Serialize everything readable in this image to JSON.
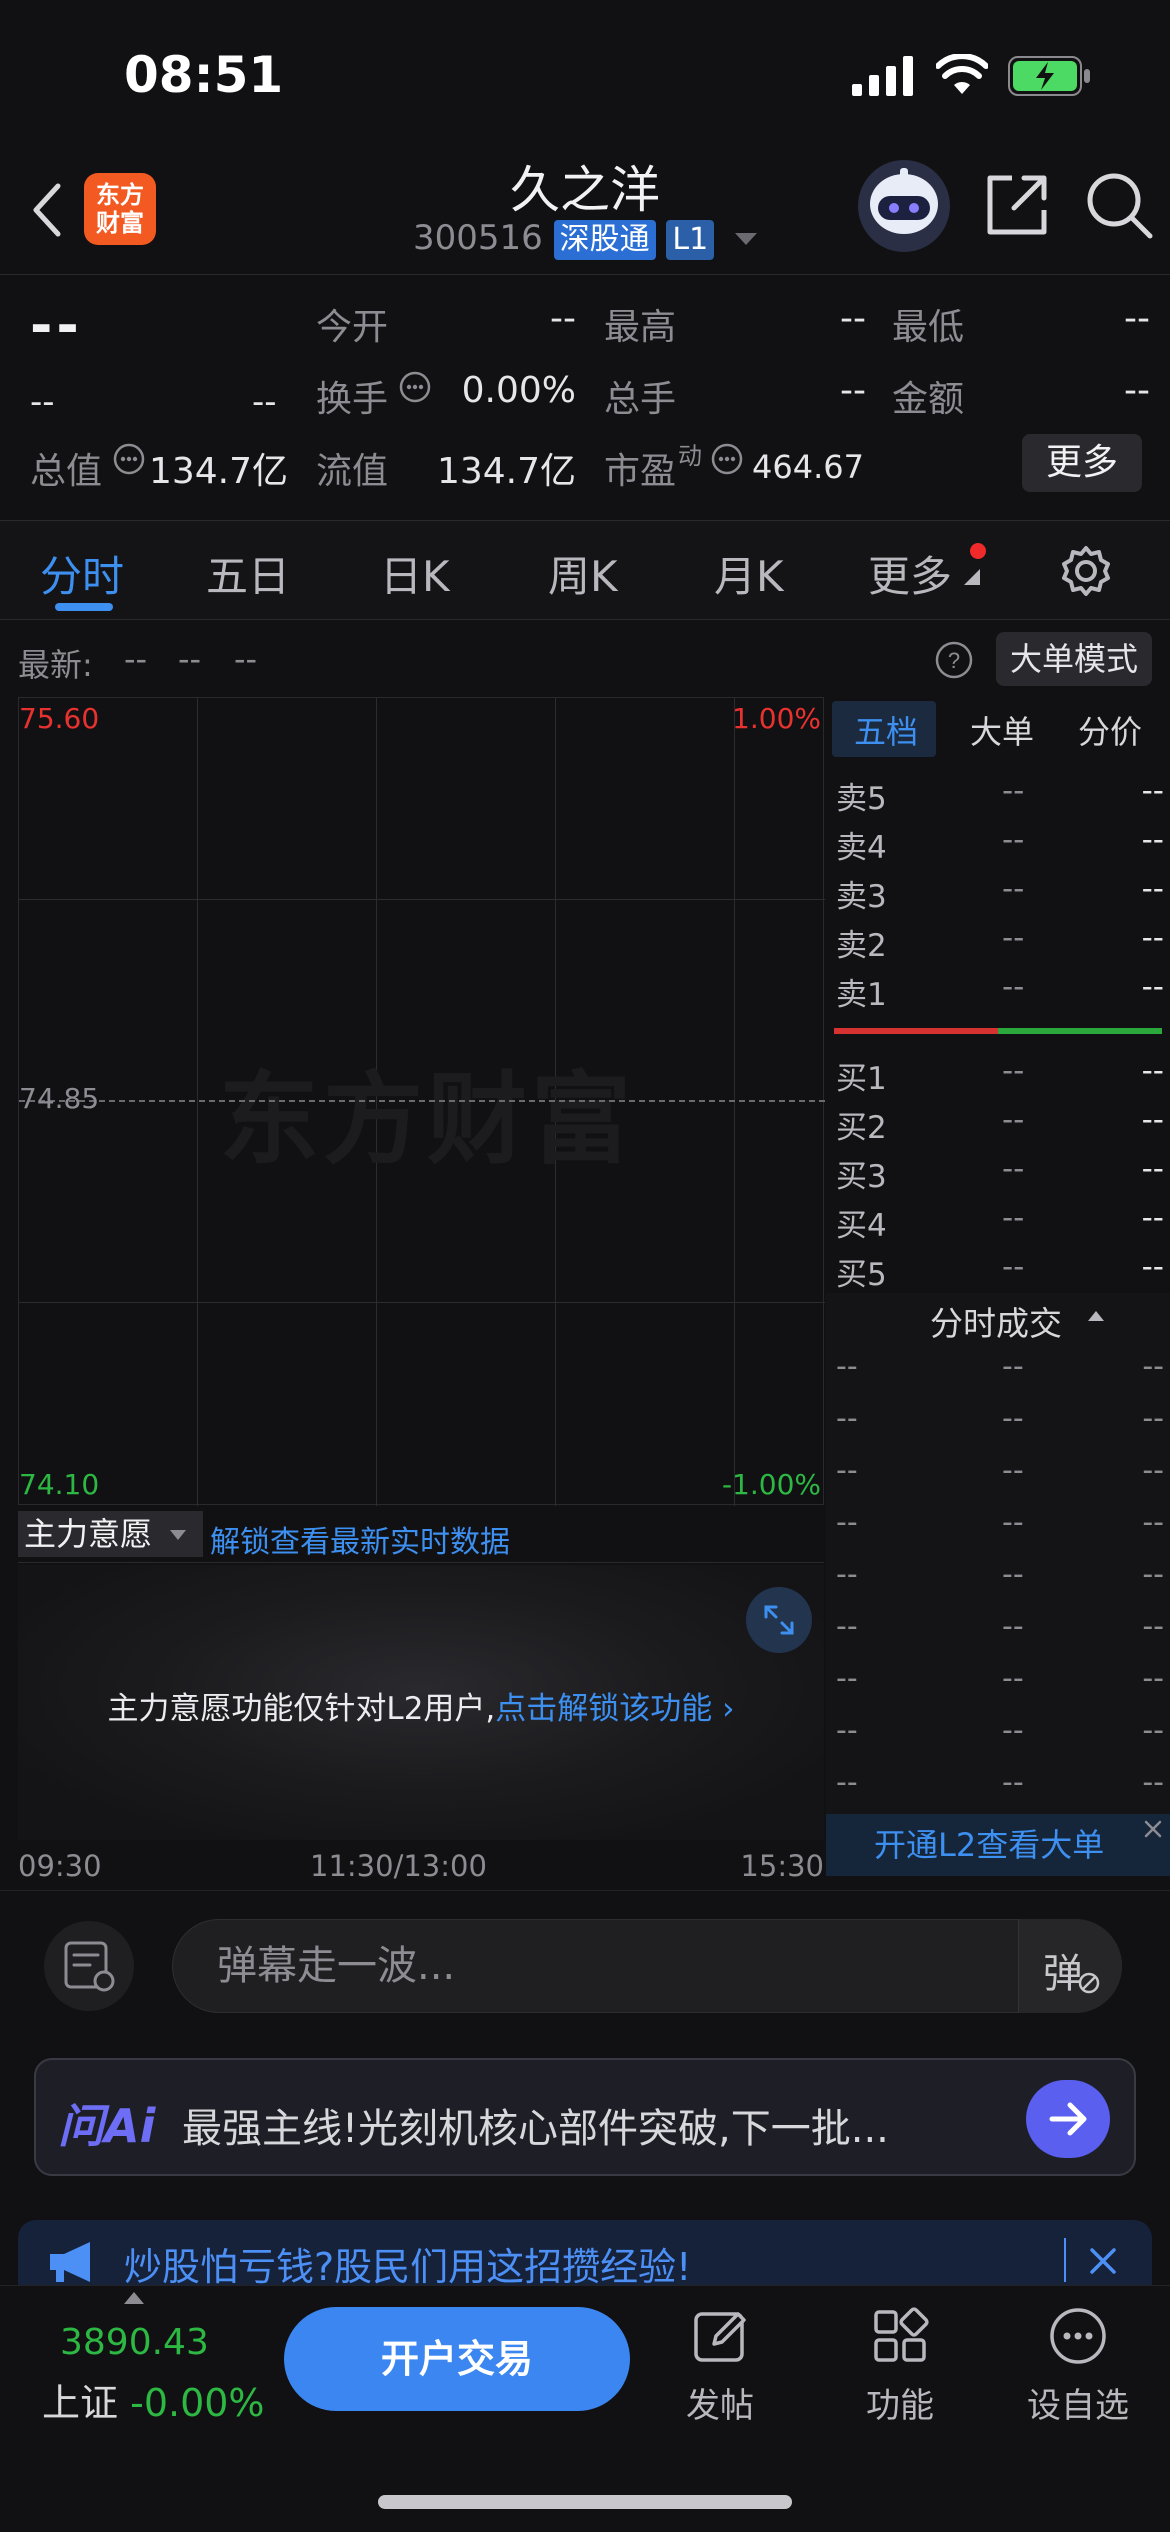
{
  "status": {
    "time": "08:51"
  },
  "header": {
    "name": "久之洋",
    "code": "300516",
    "connect_tag": "深股通",
    "level_tag": "L1",
    "logo_text_1": "东方",
    "logo_text_2": "财富"
  },
  "quote": {
    "price": "--",
    "change": "--",
    "change_pct": "--",
    "open_label": "今开",
    "open_val": "--",
    "high_label": "最高",
    "high_val": "--",
    "low_label": "最低",
    "low_val": "--",
    "turnover_label": "换手",
    "turnover_val": "0.00%",
    "volume_label": "总手",
    "volume_val": "--",
    "amount_label": "金额",
    "amount_val": "--",
    "mktcap_label": "总值",
    "mktcap_val": "134.7亿",
    "float_label": "流值",
    "float_val": "134.7亿",
    "pe_label": "市盈",
    "pe_sup": "动",
    "pe_val": "464.67",
    "more_label": "更多"
  },
  "tabs": [
    {
      "label": "分时",
      "active": true
    },
    {
      "label": "五日"
    },
    {
      "label": "日K"
    },
    {
      "label": "周K"
    },
    {
      "label": "月K"
    },
    {
      "label": "更多"
    }
  ],
  "latest": {
    "label": "最新:",
    "v1": "--",
    "v2": "--",
    "v3": "--",
    "bigorder_label": "大单模式"
  },
  "chart": {
    "y_top": "75.60",
    "y_mid": "74.85",
    "y_bottom": "74.10",
    "pct_top": "1.00%",
    "pct_bottom": "-1.00%",
    "watermark": "东方财富",
    "time_start": "09:30",
    "time_mid": "11:30/13:00",
    "time_end": "15:30"
  },
  "main_force": {
    "select_label": "主力意愿",
    "unlock_link": "解锁查看最新实时数据",
    "panel_text": "主力意愿功能仅针对L2用户,",
    "panel_link": "点击解锁该功能"
  },
  "order_book": {
    "tabs": [
      "五档",
      "大单",
      "分价"
    ],
    "sell": [
      {
        "name": "卖5",
        "price": "--",
        "vol": "--"
      },
      {
        "name": "卖4",
        "price": "--",
        "vol": "--"
      },
      {
        "name": "卖3",
        "price": "--",
        "vol": "--"
      },
      {
        "name": "卖2",
        "price": "--",
        "vol": "--"
      },
      {
        "name": "卖1",
        "price": "--",
        "vol": "--"
      }
    ],
    "buy": [
      {
        "name": "买1",
        "price": "--",
        "vol": "--"
      },
      {
        "name": "买2",
        "price": "--",
        "vol": "--"
      },
      {
        "name": "买3",
        "price": "--",
        "vol": "--"
      },
      {
        "name": "买4",
        "price": "--",
        "vol": "--"
      },
      {
        "name": "买5",
        "price": "--",
        "vol": "--"
      }
    ],
    "deals_title": "分时成交",
    "deal_placeholder": "--",
    "l2_banner": "开通L2查看大单"
  },
  "danmaku": {
    "placeholder": "弹幕走一波...",
    "toggle": "弹"
  },
  "ai": {
    "logo": "问Ai",
    "text": "最强主线!光刻机核心部件突破,下一批..."
  },
  "notice": {
    "text": "炒股怕亏钱?股民们用这招攒经验!"
  },
  "bottom": {
    "index_value": "3890.43",
    "index_name": "上证",
    "index_change": "-0.00%",
    "trade_label": "开户交易",
    "post_label": "发帖",
    "func_label": "功能",
    "watch_label": "设自选"
  }
}
